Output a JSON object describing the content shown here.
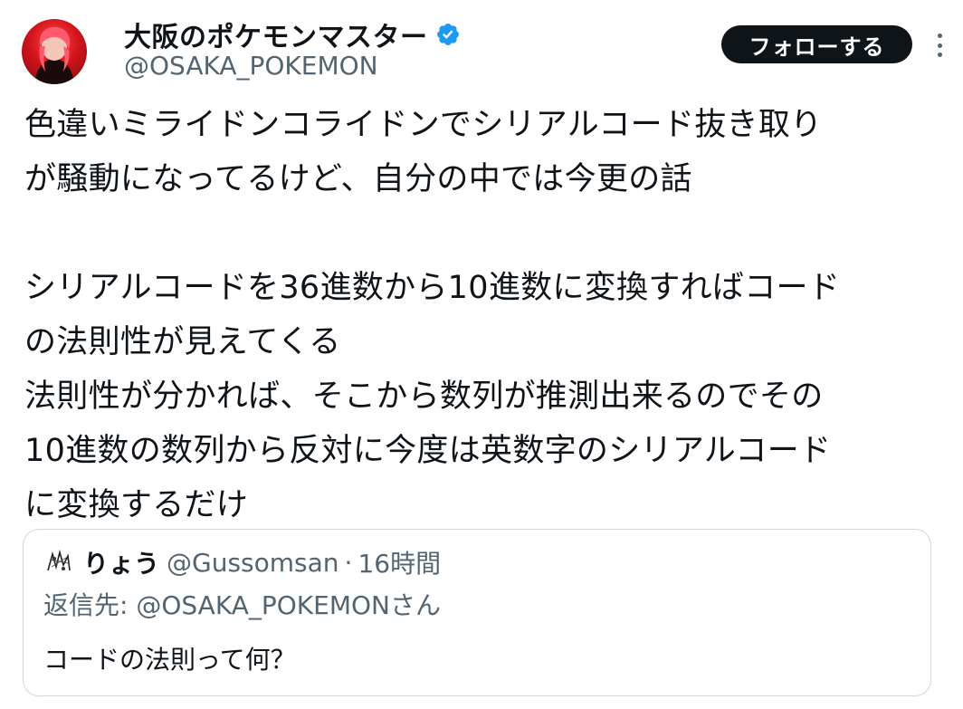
{
  "author": {
    "display_name": "大阪のポケモンマスター",
    "handle": "@OSAKA_POKEMON",
    "verified": true,
    "avatar_icon": "profile-avatar"
  },
  "header": {
    "follow_label": "フォローする",
    "more_icon": "more-vertical-icon"
  },
  "tweet": {
    "lines": [
      "色違いミライドンコライドンでシリアルコード抜き取り",
      "が騒動になってるけど、自分の中では今更の話",
      "",
      "シリアルコードを36進数から10進数に変換すればコード",
      "の法則性が見えてくる",
      "法則性が分かれば、そこから数列が推測出来るのでその",
      "10進数の数列から反対に今度は英数字のシリアルコード",
      "に変換するだけ"
    ]
  },
  "quote": {
    "display_name": "りょう",
    "handle": "@Gussomsan",
    "separator": "·",
    "time": "16時間",
    "reply_to": "返信先: @OSAKA_POKEMONさん",
    "body": "コードの法則って何？"
  },
  "colors": {
    "text_primary": "#0f1419",
    "text_secondary": "#536471",
    "verified_blue": "#1d9bf0",
    "follow_bg": "#0f1419",
    "border": "#cfd9de"
  }
}
